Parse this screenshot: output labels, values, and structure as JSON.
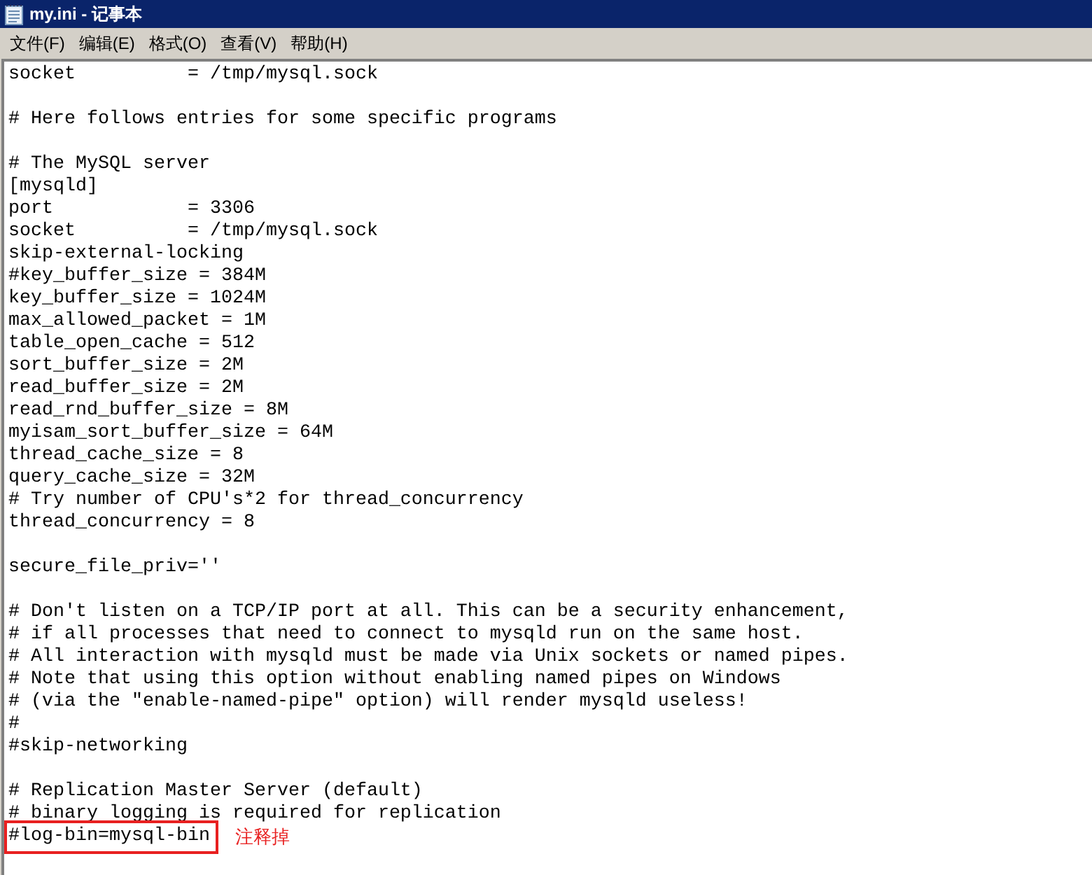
{
  "window": {
    "title": "my.ini - 记事本"
  },
  "menu": [
    "文件(F)",
    "编辑(E)",
    "格式(O)",
    "查看(V)",
    "帮助(H)"
  ],
  "lines": [
    {
      "kind": "text",
      "text": "socket          = /tmp/mysql.sock"
    },
    {
      "kind": "blank"
    },
    {
      "kind": "text",
      "text": "# Here follows entries for some specific programs"
    },
    {
      "kind": "blank"
    },
    {
      "kind": "text",
      "text": "# The MySQL server"
    },
    {
      "kind": "text",
      "text": "[mysqld]"
    },
    {
      "kind": "text",
      "text": "port            = 3306"
    },
    {
      "kind": "text",
      "text": "socket          = /tmp/mysql.sock"
    },
    {
      "kind": "text",
      "text": "skip-external-locking"
    },
    {
      "kind": "text",
      "text": "#key_buffer_size = 384M"
    },
    {
      "kind": "text",
      "text": "key_buffer_size = 1024M"
    },
    {
      "kind": "text",
      "text": "max_allowed_packet = 1M"
    },
    {
      "kind": "text",
      "text": "table_open_cache = 512"
    },
    {
      "kind": "text",
      "text": "sort_buffer_size = 2M"
    },
    {
      "kind": "text",
      "text": "read_buffer_size = 2M"
    },
    {
      "kind": "text",
      "text": "read_rnd_buffer_size = 8M"
    },
    {
      "kind": "text",
      "text": "myisam_sort_buffer_size = 64M"
    },
    {
      "kind": "text",
      "text": "thread_cache_size = 8"
    },
    {
      "kind": "text",
      "text": "query_cache_size = 32M"
    },
    {
      "kind": "text",
      "text": "# Try number of CPU's*2 for thread_concurrency"
    },
    {
      "kind": "text",
      "text": "thread_concurrency = 8"
    },
    {
      "kind": "blank"
    },
    {
      "kind": "text",
      "text": "secure_file_priv=''"
    },
    {
      "kind": "blank"
    },
    {
      "kind": "text",
      "text": "# Don't listen on a TCP/IP port at all. This can be a security enhancement,"
    },
    {
      "kind": "text",
      "text": "# if all processes that need to connect to mysqld run on the same host."
    },
    {
      "kind": "text",
      "text": "# All interaction with mysqld must be made via Unix sockets or named pipes."
    },
    {
      "kind": "text",
      "text": "# Note that using this option without enabling named pipes on Windows"
    },
    {
      "kind": "text",
      "text": "# (via the \"enable-named-pipe\" option) will render mysqld useless!"
    },
    {
      "kind": "text",
      "text": "#"
    },
    {
      "kind": "text",
      "text": "#skip-networking"
    },
    {
      "kind": "blank"
    },
    {
      "kind": "text",
      "text": "# Replication Master Server (default)"
    },
    {
      "kind": "text",
      "text": "# binary logging is required for replication"
    },
    {
      "kind": "annotated",
      "text": "#log-bin=mysql-bin",
      "note": "注释掉"
    }
  ]
}
